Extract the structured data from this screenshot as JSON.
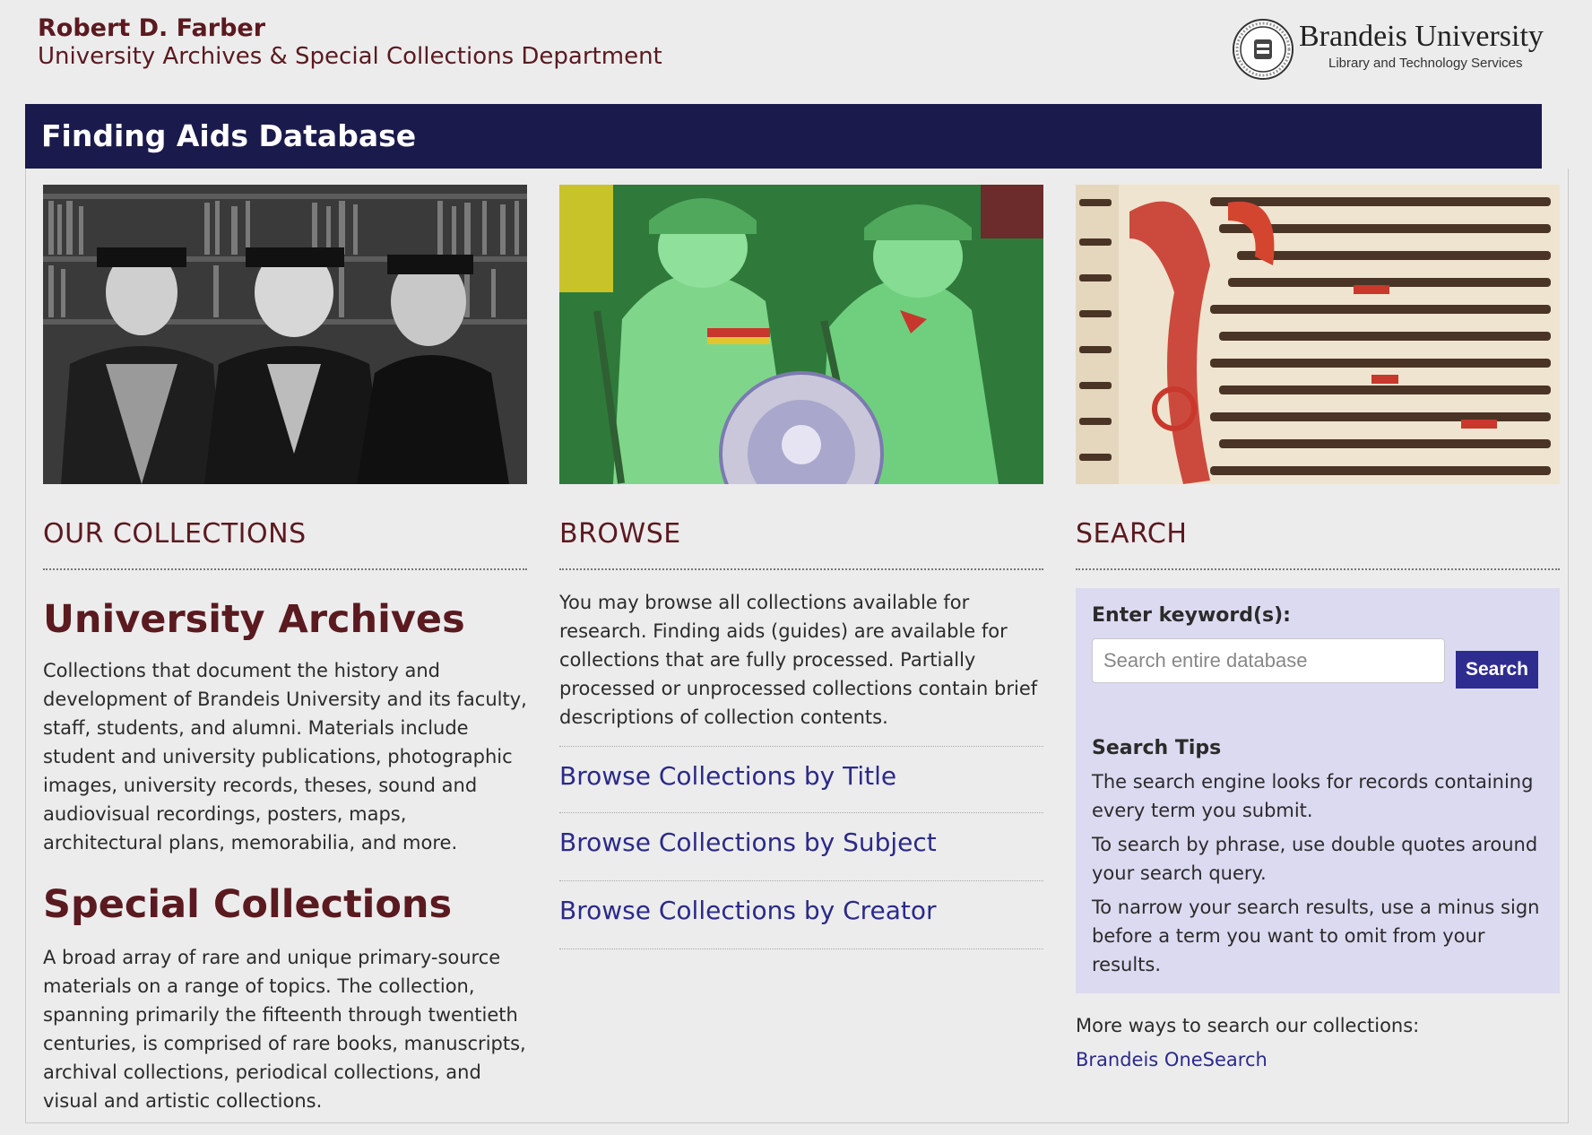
{
  "header": {
    "name": "Robert D. Farber",
    "department": "University Archives & Special Collections Department",
    "brand_name": "Brandeis University",
    "brand_sub": "Library and Technology Services"
  },
  "banner": {
    "title": "Finding Aids Database"
  },
  "collections": {
    "heading": "OUR COLLECTIONS",
    "archives_title": "University Archives",
    "archives_desc": "Collections that document the history and development of Brandeis University and its faculty, staff, students, and alumni. Materials include student and university publications, photographic images, university records, theses, sound and audiovisual recordings, posters, maps, architectural plans, memorabilia, and more.",
    "special_title": "Special Collections",
    "special_desc": "A broad array of rare and unique primary-source materials on a range of topics. The collection, spanning primarily the fifteenth through twentieth centuries, is comprised of rare books, manuscripts, archival collections, periodical collections, and visual and artistic collections."
  },
  "browse": {
    "heading": "BROWSE",
    "desc": "You may browse all collections available for research. Finding aids (guides) are available for collections that are fully processed. Partially processed or unprocessed collections contain brief descriptions of collection contents.",
    "links": [
      {
        "label": "Browse Collections by Title"
      },
      {
        "label": "Browse Collections by Subject"
      },
      {
        "label": "Browse Collections by Creator"
      }
    ]
  },
  "search": {
    "heading": "SEARCH",
    "keyword_label": "Enter keyword(s):",
    "placeholder": "Search entire database",
    "button": "Search",
    "tips_heading": "Search Tips",
    "tips": [
      "The search engine looks for records containing every term you submit.",
      "To search by phrase, use double quotes around your search query.",
      "To narrow your search results, use a minus sign before a term you want to omit from your results."
    ],
    "more_ways": "More ways to search our collections:",
    "onesearch": "Brandeis OneSearch"
  },
  "icons": {
    "seal": "university-seal-icon"
  },
  "colors": {
    "maroon": "#5a1a1f",
    "navy_banner": "#1b1a4c",
    "link": "#2b2a8a",
    "search_panel": "#dcdaf1",
    "search_button": "#2f2c90"
  }
}
